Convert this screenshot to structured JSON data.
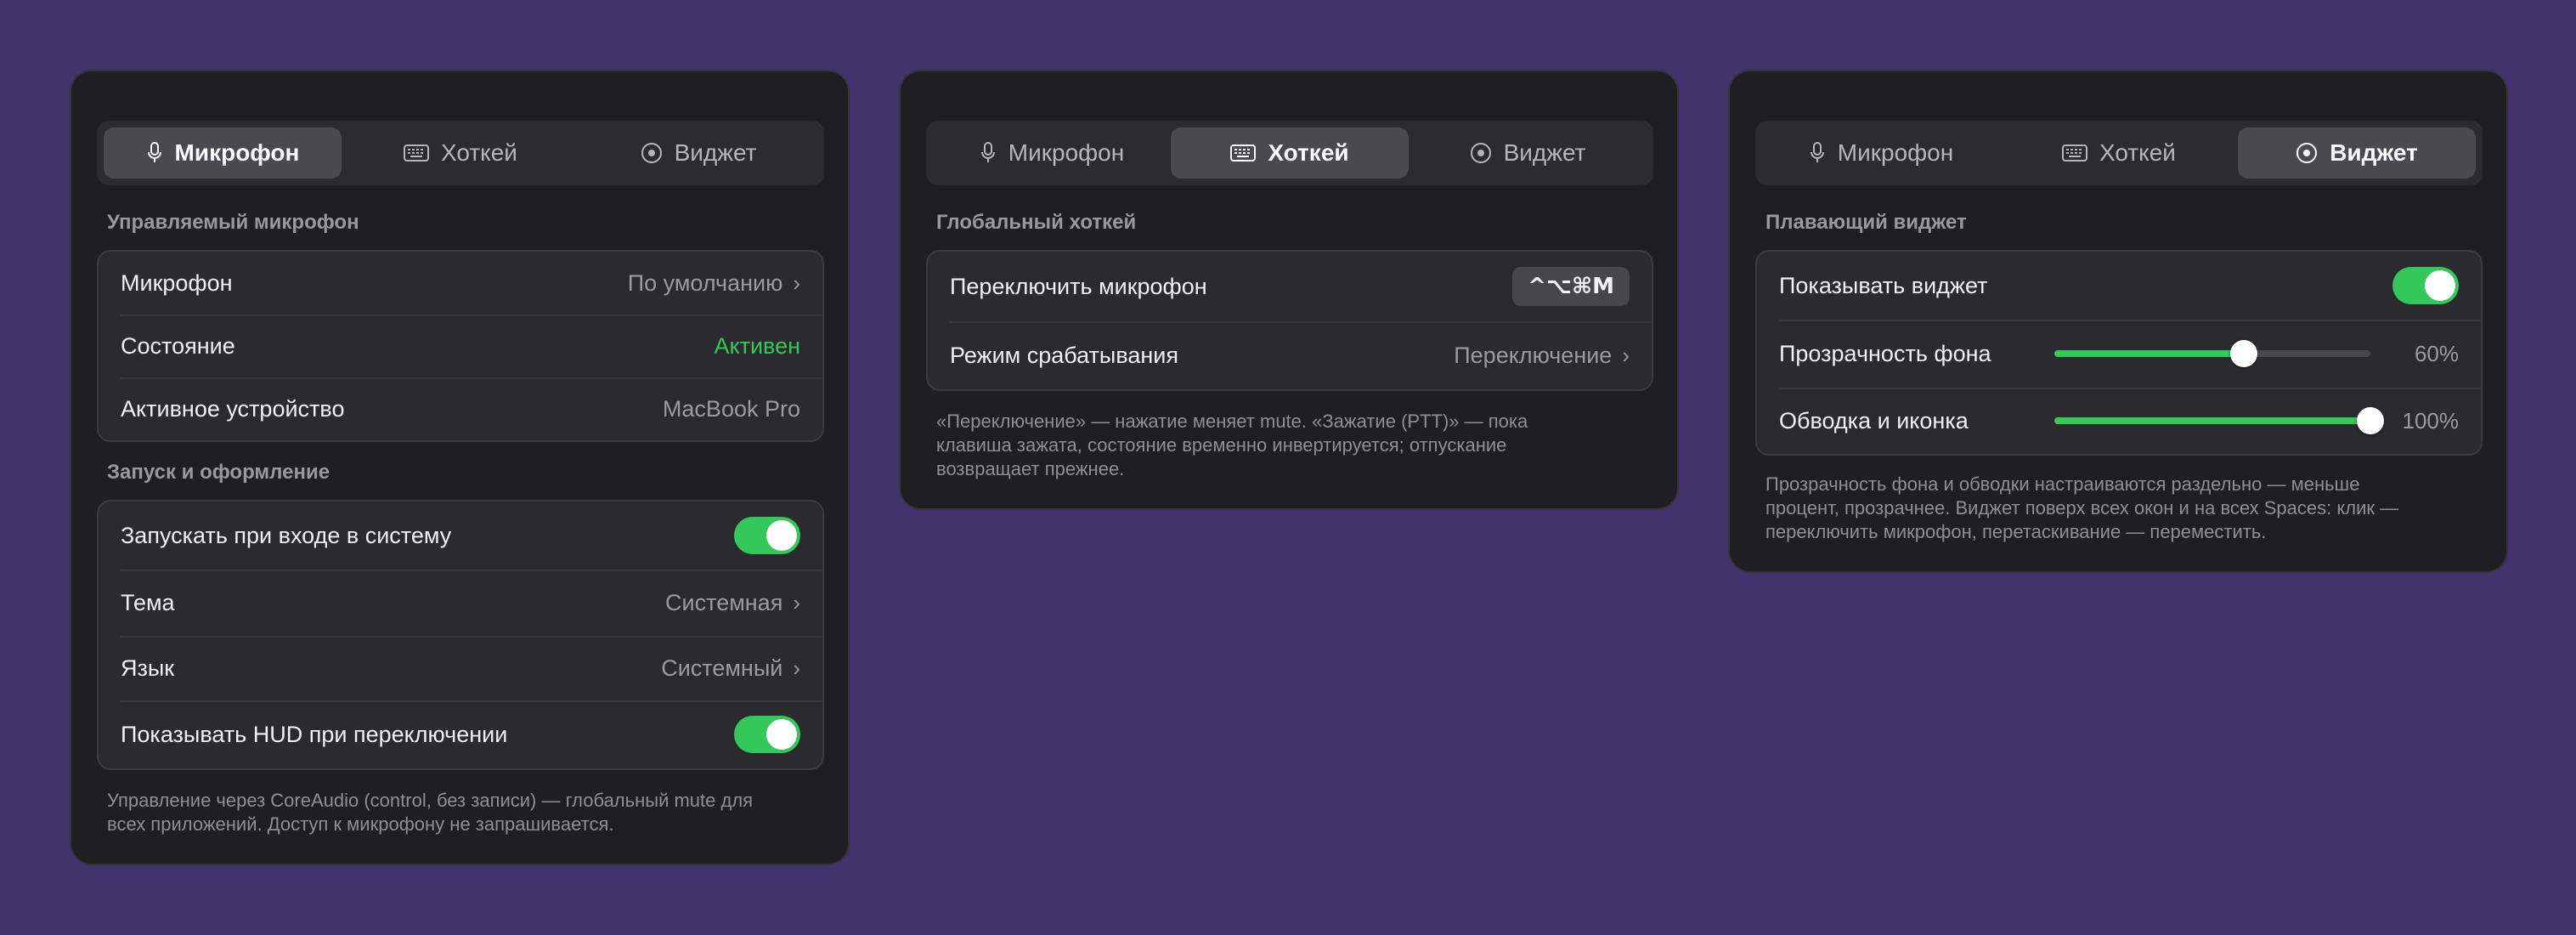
{
  "tabs": {
    "mic": "Микрофон",
    "hotkey": "Хоткей",
    "widget": "Виджет"
  },
  "panel_mic": {
    "section1_title": "Управляемый микрофон",
    "mic_label": "Микрофон",
    "mic_value": "По умолчанию",
    "state_label": "Состояние",
    "state_value": "Активен",
    "device_label": "Активное устройство",
    "device_value": "MacBook Pro",
    "section2_title": "Запуск и оформление",
    "login_label": "Запускать при входе в систему",
    "login_on": true,
    "theme_label": "Тема",
    "theme_value": "Системная",
    "lang_label": "Язык",
    "lang_value": "Системный",
    "hud_label": "Показывать HUD при переключении",
    "hud_on": true,
    "footnote_1": "Управление через CoreAudio (control, без записи) — глобальный mute для",
    "footnote_2": "всех приложений. Доступ к микрофону не запрашивается."
  },
  "panel_hotkey": {
    "section_title": "Глобальный хоткей",
    "toggle_label": "Переключить микрофон",
    "shortcut": "^⌥⌘M",
    "mode_label": "Режим срабатывания",
    "mode_value": "Переключение",
    "footnote_1": "«Переключение» — нажатие меняет mute. «Зажатие (PTT)» — пока",
    "footnote_2": "клавиша зажата, состояние временно инвертируется; отпускание",
    "footnote_3": "возвращает прежнее."
  },
  "panel_widget": {
    "section_title": "Плавающий виджет",
    "show_label": "Показывать виджет",
    "show_on": true,
    "bg_opacity_label": "Прозрачность фона",
    "bg_opacity_text": "60%",
    "bg_opacity_value": 0.6,
    "outline_label": "Обводка и иконка",
    "outline_text": "100%",
    "outline_value": 1.0,
    "footnote_1": "Прозрачность фона и обводки настраиваются раздельно — меньше",
    "footnote_2": "процент, прозрачнее. Виджет поверх всех окон и на всех Spaces: клик —",
    "footnote_3": "переключить микрофон, перетаскивание — переместить."
  },
  "colors": {
    "background": "#41336b",
    "accent_green": "#34c759",
    "panel": "#1f1f23"
  }
}
